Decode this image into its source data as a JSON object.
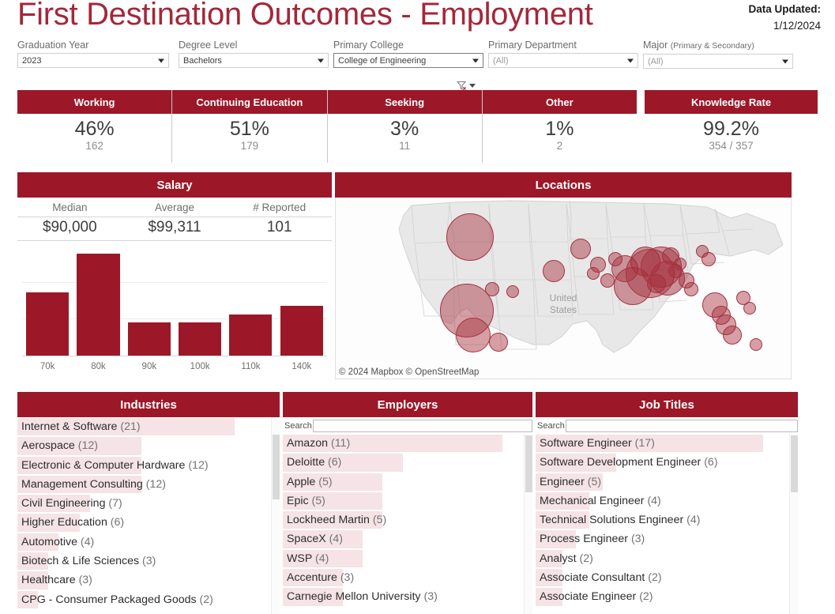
{
  "header": {
    "title": "First Destination Outcomes - Employment",
    "updated_label": "Data Updated:",
    "updated_date": "1/12/2024"
  },
  "filters": [
    {
      "name": "graduation-year",
      "label": "Graduation Year",
      "value": "2023",
      "muted": false,
      "active": false
    },
    {
      "name": "degree-level",
      "label": "Degree Level",
      "value": "Bachelors",
      "muted": false,
      "active": false
    },
    {
      "name": "primary-college",
      "label": "Primary College",
      "value": "College of Engineering",
      "muted": false,
      "active": true
    },
    {
      "name": "primary-department",
      "label": "Primary Department",
      "value": "(All)",
      "muted": true,
      "active": false
    },
    {
      "name": "major",
      "label": "Major ",
      "label_sub": "(Primary & Secondary)",
      "value": "(All)",
      "muted": true,
      "active": false
    }
  ],
  "kpis": {
    "main": [
      {
        "label": "Working",
        "value": "46%",
        "sub": "162"
      },
      {
        "label": "Continuing Education",
        "value": "51%",
        "sub": "179"
      },
      {
        "label": "Seeking",
        "value": "3%",
        "sub": "11"
      },
      {
        "label": "Other",
        "value": "1%",
        "sub": "2"
      }
    ],
    "extra": {
      "label": "Knowledge Rate",
      "value": "99.2%",
      "sub": "354 / 357"
    }
  },
  "salary": {
    "title": "Salary",
    "stats": [
      {
        "label": "Median",
        "value": "$90,000"
      },
      {
        "label": "Average",
        "value": "$99,311"
      },
      {
        "label": "# Reported",
        "value": "101"
      }
    ]
  },
  "locations": {
    "title": "Locations",
    "map_label": "United\nStates",
    "attribution": "© 2024 Mapbox  © OpenStreetMap"
  },
  "industries": {
    "title": "Industries",
    "items": [
      {
        "label": "Internet & Software",
        "count": 21
      },
      {
        "label": "Aerospace",
        "count": 12
      },
      {
        "label": "Electronic & Computer Hardware",
        "count": 12
      },
      {
        "label": "Management Consulting",
        "count": 12
      },
      {
        "label": "Civil Engineering",
        "count": 7
      },
      {
        "label": "Higher Education",
        "count": 6
      },
      {
        "label": "Automotive",
        "count": 4
      },
      {
        "label": "Biotech & Life Sciences",
        "count": 3
      },
      {
        "label": "Healthcare",
        "count": 3
      },
      {
        "label": "CPG - Consumer Packaged Goods",
        "count": 2
      }
    ]
  },
  "employers": {
    "title": "Employers",
    "search_label": "Search",
    "search_value": "",
    "search_placeholder": "",
    "items": [
      {
        "label": "Amazon",
        "count": 11
      },
      {
        "label": "Deloitte",
        "count": 6
      },
      {
        "label": "Apple",
        "count": 5
      },
      {
        "label": "Epic",
        "count": 5
      },
      {
        "label": "Lockheed Martin",
        "count": 5
      },
      {
        "label": "SpaceX",
        "count": 4
      },
      {
        "label": "WSP",
        "count": 4
      },
      {
        "label": "Accenture",
        "count": 3
      },
      {
        "label": "Carnegie Mellon University",
        "count": 3
      }
    ]
  },
  "jobtitles": {
    "title": "Job Titles",
    "search_label": "Search",
    "search_value": "",
    "search_placeholder": "",
    "items": [
      {
        "label": "Software Engineer",
        "count": 17
      },
      {
        "label": "Software Development Engineer",
        "count": 6
      },
      {
        "label": "Engineer",
        "count": 5
      },
      {
        "label": "Mechanical Engineer",
        "count": 4
      },
      {
        "label": "Technical Solutions Engineer",
        "count": 4
      },
      {
        "label": "Process Engineer",
        "count": 3
      },
      {
        "label": "Analyst",
        "count": 2
      },
      {
        "label": "Associate Consultant",
        "count": 2
      },
      {
        "label": "Associate Engineer",
        "count": 2
      }
    ]
  },
  "colors": {
    "brand": "#9c1828",
    "title": "#a4273a",
    "bar": "#9c1828",
    "list_fill": "#f5e3e5",
    "map_dot": "#a5323f"
  },
  "chart_data": [
    {
      "type": "bar",
      "title": "Salary",
      "categories": [
        "70k",
        "80k",
        "90k",
        "100k",
        "110k",
        "140k"
      ],
      "values": [
        23,
        37,
        12,
        12,
        15,
        18
      ],
      "xlabel": "",
      "ylabel": "",
      "ylim": [
        0,
        40
      ],
      "grid": true,
      "legend": "none",
      "note": "Salary distribution histogram; y-axis unlabeled, values estimated from gridlines"
    },
    {
      "type": "bar",
      "title": "Industries",
      "categories": [
        "Internet & Software",
        "Aerospace",
        "Electronic & Computer Hardware",
        "Management Consulting",
        "Civil Engineering",
        "Higher Education",
        "Automotive",
        "Biotech & Life Sciences",
        "Healthcare",
        "CPG - Consumer Packaged Goods"
      ],
      "values": [
        21,
        12,
        12,
        12,
        7,
        6,
        4,
        3,
        3,
        2
      ],
      "xlabel": "",
      "ylabel": "",
      "legend": "none"
    },
    {
      "type": "bar",
      "title": "Employers",
      "categories": [
        "Amazon",
        "Deloitte",
        "Apple",
        "Epic",
        "Lockheed Martin",
        "SpaceX",
        "WSP",
        "Accenture",
        "Carnegie Mellon University"
      ],
      "values": [
        11,
        6,
        5,
        5,
        5,
        4,
        4,
        3,
        3
      ],
      "xlabel": "",
      "ylabel": "",
      "legend": "none"
    },
    {
      "type": "bar",
      "title": "Job Titles",
      "categories": [
        "Software Engineer",
        "Software Development Engineer",
        "Engineer",
        "Mechanical Engineer",
        "Technical Solutions Engineer",
        "Process Engineer",
        "Analyst",
        "Associate Consultant",
        "Associate Engineer"
      ],
      "values": [
        17,
        6,
        5,
        4,
        4,
        3,
        2,
        2,
        2
      ],
      "xlabel": "",
      "ylabel": "",
      "legend": "none"
    },
    {
      "type": "scatter",
      "title": "Locations",
      "note": "Proportional-symbol map of the United States; bubble size encodes graduate count per metro area",
      "x": [
        85,
        83,
        87,
        99,
        103,
        112,
        138,
        155,
        163,
        166,
        172,
        177,
        183,
        188,
        196,
        199,
        203,
        206,
        210,
        212,
        215,
        218,
        222,
        225,
        232,
        236,
        240,
        244,
        247,
        251,
        258,
        262,
        266
      ],
      "y": [
        32,
        92,
        112,
        75,
        118,
        77,
        60,
        42,
        62,
        55,
        68,
        50,
        58,
        72,
        52,
        62,
        70,
        57,
        66,
        48,
        60,
        54,
        68,
        75,
        44,
        50,
        88,
        96,
        104,
        112,
        82,
        90,
        120
      ],
      "sizes": [
        30,
        34,
        22,
        9,
        12,
        8,
        14,
        13,
        8,
        10,
        9,
        9,
        17,
        24,
        19,
        31,
        12,
        26,
        22,
        11,
        9,
        8,
        10,
        9,
        8,
        9,
        16,
        12,
        13,
        12,
        9,
        8,
        8
      ]
    }
  ]
}
